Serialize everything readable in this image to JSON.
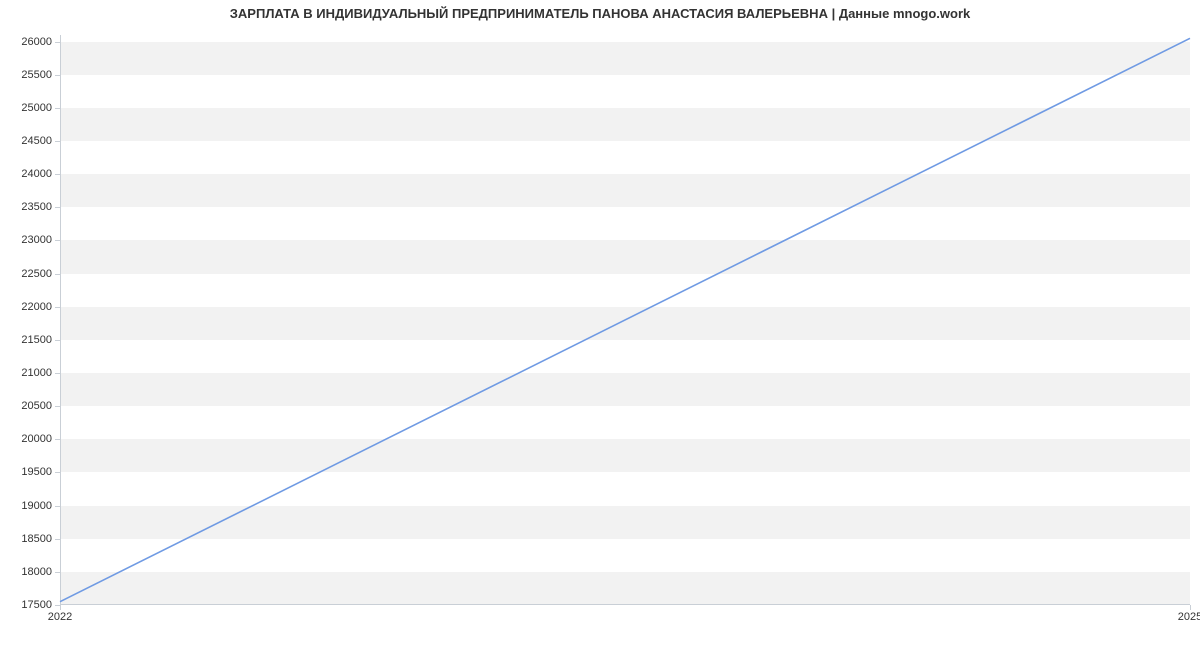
{
  "chart_data": {
    "type": "line",
    "title": "ЗАРПЛАТА В ИНДИВИДУАЛЬНЫЙ ПРЕДПРИНИМАТЕЛЬ ПАНОВА АНАСТАСИЯ ВАЛЕРЬЕВНА | Данные mnogo.work",
    "xlabel": "",
    "ylabel": "",
    "x_ticks": [
      "2022",
      "2025"
    ],
    "y_ticks": [
      17500,
      18000,
      18500,
      19000,
      19500,
      20000,
      20500,
      21000,
      21500,
      22000,
      22500,
      23000,
      23500,
      24000,
      24500,
      25000,
      25500,
      26000
    ],
    "ylim": [
      17500,
      26100
    ],
    "xlim": [
      2022,
      2025
    ],
    "series": [
      {
        "name": "salary",
        "x": [
          2022,
          2025
        ],
        "values": [
          17550,
          26050
        ],
        "color": "#6f9ae3"
      }
    ],
    "bands_between": [
      [
        17500,
        18000
      ],
      [
        18500,
        19000
      ],
      [
        19500,
        20000
      ],
      [
        20500,
        21000
      ],
      [
        21500,
        22000
      ],
      [
        22500,
        23000
      ],
      [
        23500,
        24000
      ],
      [
        24500,
        25000
      ],
      [
        25500,
        26000
      ]
    ]
  }
}
